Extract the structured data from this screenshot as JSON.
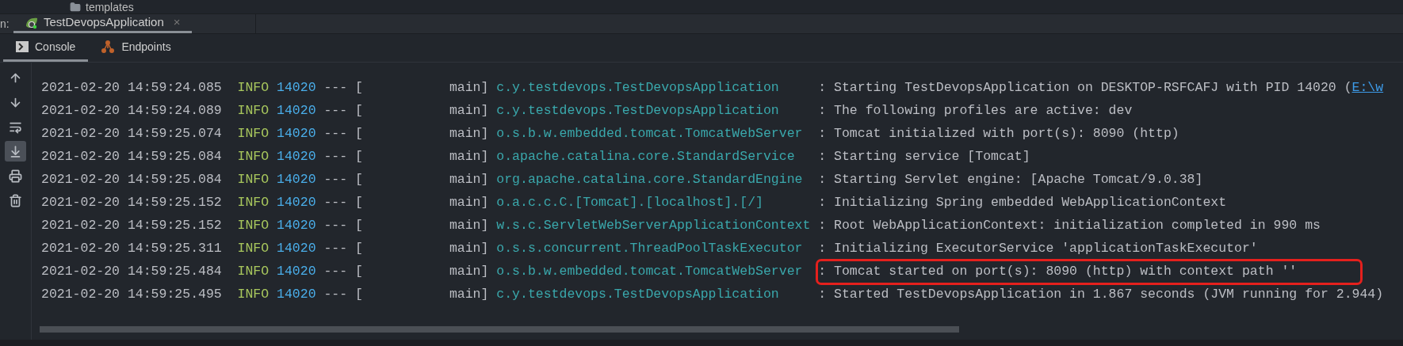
{
  "project_tree": {
    "item": "templates"
  },
  "run_bar": {
    "label": "n:",
    "tabs": [
      {
        "label": "TestDevopsApplication",
        "close": "×",
        "selected": true
      }
    ]
  },
  "console_tabs": [
    {
      "label": "Console",
      "kind": "console",
      "selected": true
    },
    {
      "label": "Endpoints",
      "kind": "endpoints",
      "selected": false
    }
  ],
  "toolbar": [
    {
      "kind": "up",
      "selected": false
    },
    {
      "kind": "down",
      "selected": false
    },
    {
      "kind": "wrap",
      "selected": false
    },
    {
      "kind": "scroll_end",
      "selected": true
    },
    {
      "kind": "print",
      "selected": false
    },
    {
      "kind": "clear",
      "selected": false
    }
  ],
  "log": [
    {
      "timestamp": "2021-02-20 14:59:24.085",
      "level": "INFO",
      "pid": "14020",
      "sep": "---",
      "thread": "[           main]",
      "logger": "c.y.testdevops.TestDevopsApplication",
      "message": ": Starting TestDevopsApplication on DESKTOP-RSFCAFJ with PID 14020 (",
      "link": "E:\\w",
      "highlighted": false
    },
    {
      "timestamp": "2021-02-20 14:59:24.089",
      "level": "INFO",
      "pid": "14020",
      "sep": "---",
      "thread": "[           main]",
      "logger": "c.y.testdevops.TestDevopsApplication",
      "message": ": The following profiles are active: dev",
      "highlighted": false
    },
    {
      "timestamp": "2021-02-20 14:59:25.074",
      "level": "INFO",
      "pid": "14020",
      "sep": "---",
      "thread": "[           main]",
      "logger": "o.s.b.w.embedded.tomcat.TomcatWebServer",
      "message": ": Tomcat initialized with port(s): 8090 (http)",
      "highlighted": false
    },
    {
      "timestamp": "2021-02-20 14:59:25.084",
      "level": "INFO",
      "pid": "14020",
      "sep": "---",
      "thread": "[           main]",
      "logger": "o.apache.catalina.core.StandardService",
      "message": ": Starting service [Tomcat]",
      "highlighted": false
    },
    {
      "timestamp": "2021-02-20 14:59:25.084",
      "level": "INFO",
      "pid": "14020",
      "sep": "---",
      "thread": "[           main]",
      "logger": "org.apache.catalina.core.StandardEngine",
      "message": ": Starting Servlet engine: [Apache Tomcat/9.0.38]",
      "highlighted": false
    },
    {
      "timestamp": "2021-02-20 14:59:25.152",
      "level": "INFO",
      "pid": "14020",
      "sep": "---",
      "thread": "[           main]",
      "logger": "o.a.c.c.C.[Tomcat].[localhost].[/]",
      "message": ": Initializing Spring embedded WebApplicationContext",
      "highlighted": false
    },
    {
      "timestamp": "2021-02-20 14:59:25.152",
      "level": "INFO",
      "pid": "14020",
      "sep": "---",
      "thread": "[           main]",
      "logger": "w.s.c.ServletWebServerApplicationContext",
      "message": ": Root WebApplicationContext: initialization completed in 990 ms",
      "highlighted": false
    },
    {
      "timestamp": "2021-02-20 14:59:25.311",
      "level": "INFO",
      "pid": "14020",
      "sep": "---",
      "thread": "[           main]",
      "logger": "o.s.s.concurrent.ThreadPoolTaskExecutor",
      "message": ": Initializing ExecutorService 'applicationTaskExecutor'",
      "highlighted": false
    },
    {
      "timestamp": "2021-02-20 14:59:25.484",
      "level": "INFO",
      "pid": "14020",
      "sep": "---",
      "thread": "[           main]",
      "logger": "o.s.b.w.embedded.tomcat.TomcatWebServer",
      "message": ": Tomcat started on port(s): 8090 (http) with context path ''",
      "highlighted": true
    },
    {
      "timestamp": "2021-02-20 14:59:25.495",
      "level": "INFO",
      "pid": "14020",
      "sep": "---",
      "thread": "[           main]",
      "logger": "c.y.testdevops.TestDevopsApplication",
      "message": ": Started TestDevopsApplication in 1.867 seconds (JVM running for 2.944)",
      "highlighted": false
    }
  ]
}
